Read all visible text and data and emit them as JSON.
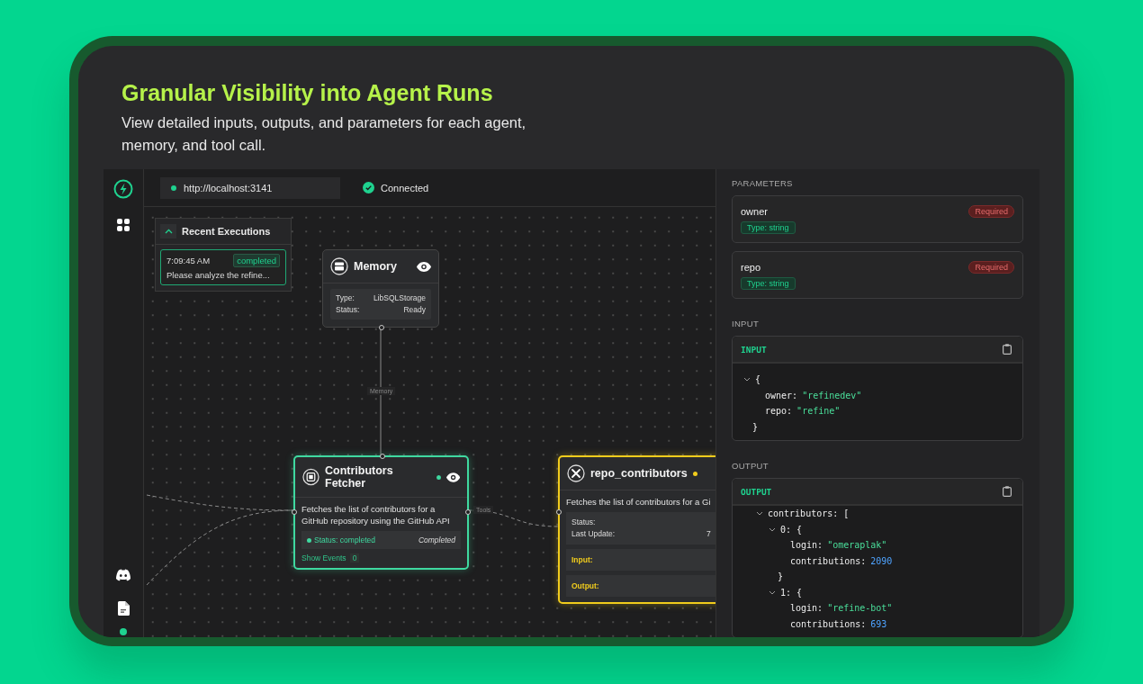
{
  "header": {
    "title": "Granular Visibility into Agent Runs",
    "subtitle": "View detailed inputs, outputs, and parameters for each agent, memory, and tool call."
  },
  "top_bar": {
    "url": "http://localhost:3141",
    "connection": "Connected"
  },
  "recent_executions": {
    "title": "Recent Executions",
    "expanded": true,
    "items": [
      {
        "time": "7:09:45 AM",
        "status": "completed",
        "preview": "Please analyze the refine..."
      }
    ]
  },
  "memory_node": {
    "title": "Memory",
    "rows": [
      {
        "label": "Type:",
        "value": "LibSQLStorage"
      },
      {
        "label": "Status:",
        "value": "Ready"
      }
    ]
  },
  "agent_node": {
    "title": "Contributors Fetcher",
    "description": "Fetches the list of contributors for a GitHub repository using the GitHub API",
    "status": "Status: completed",
    "status_note": "Completed",
    "events_link": "Show Events",
    "events_count": "0"
  },
  "tool_node": {
    "title": "repo_contributors",
    "description": "Fetches the list of contributors for a Gi",
    "rows": [
      {
        "label": "Status:",
        "value": ""
      },
      {
        "label": "Last Update:",
        "value": "7"
      }
    ],
    "sections": [
      "Input:",
      "Output:"
    ]
  },
  "edges": [
    {
      "label": "Memory"
    },
    {
      "label": "Tools"
    }
  ],
  "right_panel": {
    "parameters_heading": "PARAMETERS",
    "parameters": [
      {
        "name": "owner",
        "badge": "Required",
        "type": "Type: string"
      },
      {
        "name": "repo",
        "badge": "Required",
        "type": "Type: string"
      }
    ],
    "input_heading": "INPUT",
    "input": {
      "title": "INPUT",
      "tree": [
        {
          "open": "{",
          "expanded": true,
          "close": "}",
          "children": [
            {
              "key": "owner:",
              "value": "\"refinedev\"",
              "kind": "string"
            },
            {
              "key": "repo:",
              "value": "\"refine\"",
              "kind": "string"
            }
          ]
        }
      ]
    },
    "output_heading": "OUTPUT",
    "output": {
      "title": "OUTPUT",
      "tree": [
        {
          "key": "contributors:",
          "open": "[",
          "expanded": true,
          "children": [
            {
              "key": "0:",
              "open": "{",
              "expanded": true,
              "close": "}",
              "children": [
                {
                  "key": "login:",
                  "value": "\"omeraplak\"",
                  "kind": "string"
                },
                {
                  "key": "contributions:",
                  "value": "2090",
                  "kind": "number"
                }
              ]
            },
            {
              "key": "1:",
              "open": "{",
              "expanded": true,
              "children": [
                {
                  "key": "login:",
                  "value": "\"refine-bot\"",
                  "kind": "string"
                },
                {
                  "key": "contributions:",
                  "value": "693",
                  "kind": "number"
                }
              ]
            }
          ]
        }
      ]
    }
  }
}
